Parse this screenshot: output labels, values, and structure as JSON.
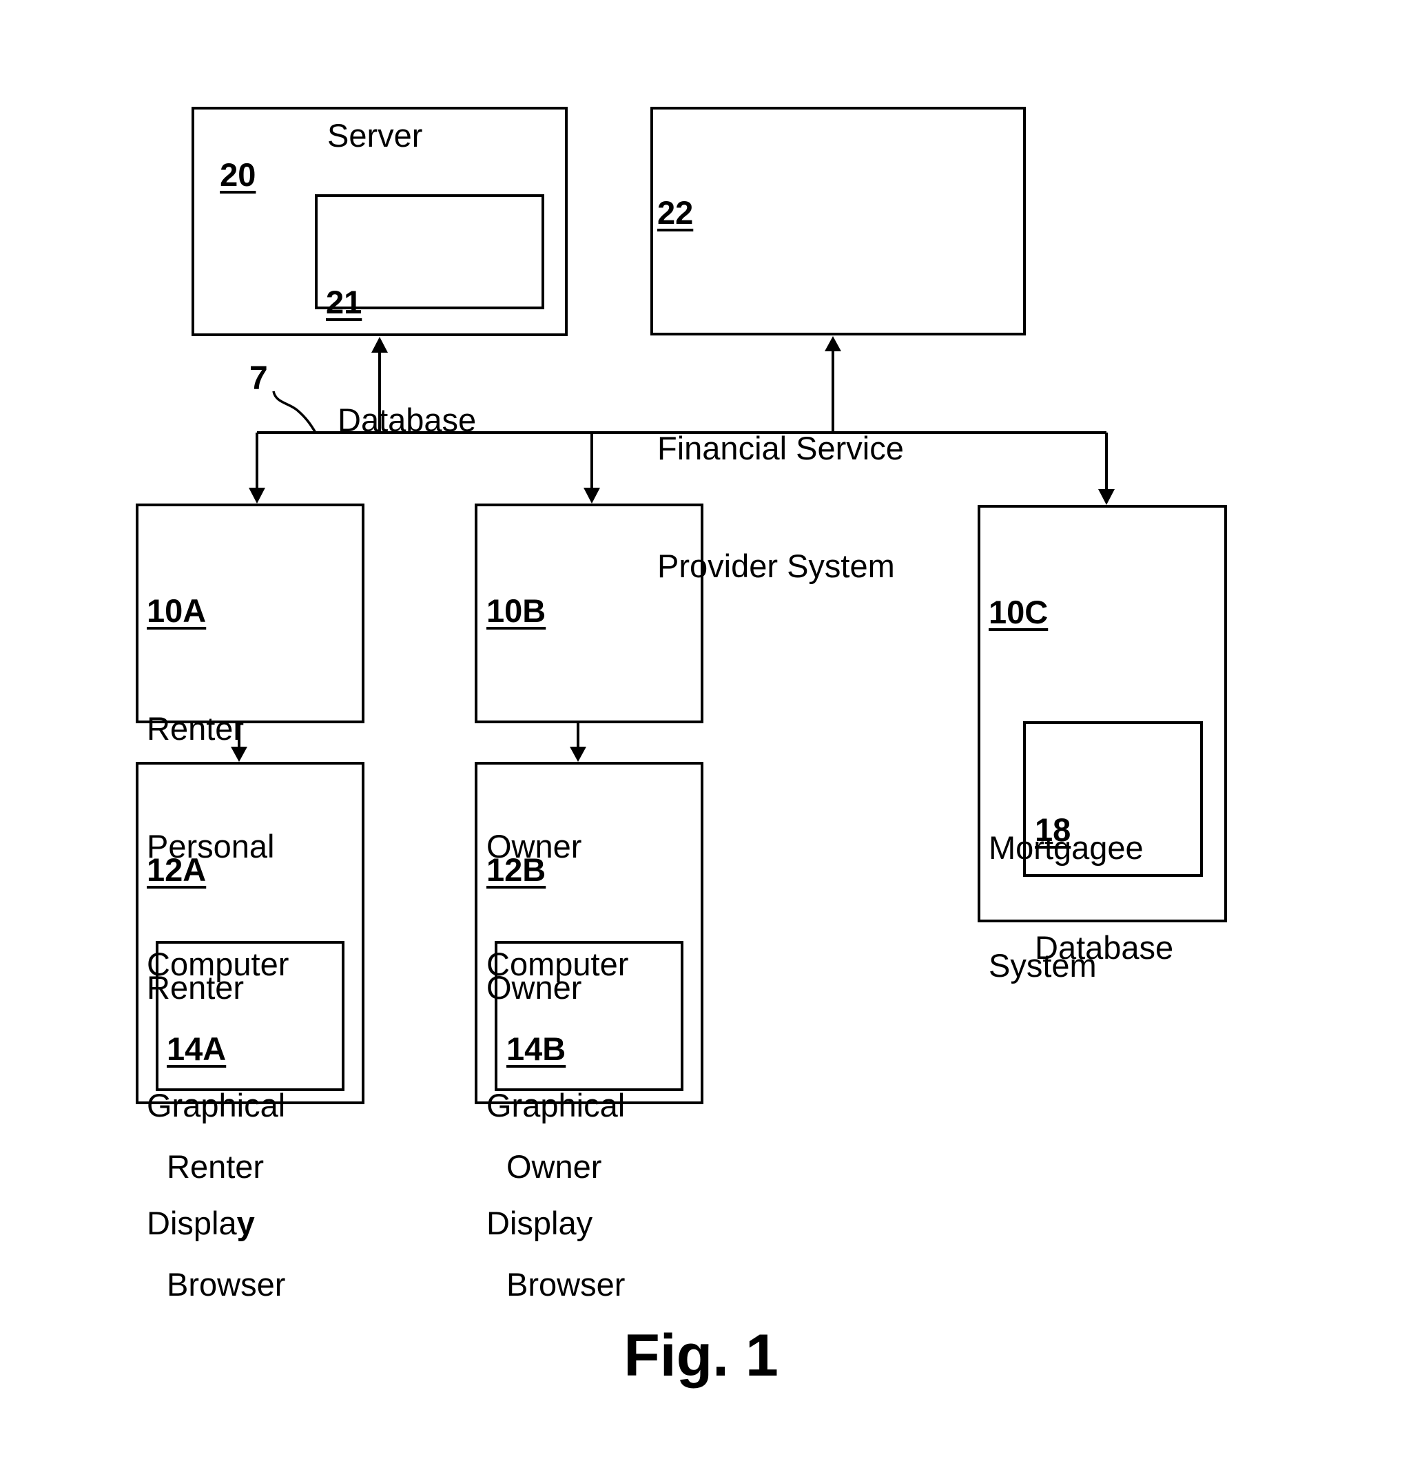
{
  "figure": {
    "caption": "Fig. 1",
    "network_ref": "7"
  },
  "nodes": {
    "server": {
      "ref": "20",
      "title": "Server"
    },
    "server_db": {
      "ref": "21",
      "lines": [
        "Database"
      ]
    },
    "fsp": {
      "ref": "22",
      "lines": [
        "Financial Service",
        "Provider System"
      ]
    },
    "renter_pc": {
      "ref": "10A",
      "lines": [
        "Renter",
        "Personal",
        "Computer"
      ]
    },
    "renter_display": {
      "ref": "12A",
      "lines": [
        "Renter",
        "Graphical",
        "Displa"
      ],
      "last_char_bold": "y"
    },
    "renter_browser": {
      "ref": "14A",
      "lines": [
        "Renter",
        "Browser"
      ]
    },
    "owner_pc": {
      "ref": "10B",
      "lines": [
        "Owner",
        "Computer"
      ]
    },
    "owner_display": {
      "ref": "12B",
      "lines": [
        "Owner",
        "Graphical",
        "Display"
      ]
    },
    "owner_browser": {
      "ref": "14B",
      "lines": [
        "Owner",
        "Browser"
      ]
    },
    "mortgagee": {
      "ref": "10C",
      "lines": [
        "Mortgagee",
        "System"
      ]
    },
    "mortgagee_db": {
      "ref": "18",
      "lines": [
        "Database"
      ]
    }
  },
  "connections": [
    {
      "from": "network",
      "to": "server",
      "direction": "up"
    },
    {
      "from": "network",
      "to": "fsp",
      "direction": "up"
    },
    {
      "from": "network",
      "to": "renter_pc",
      "direction": "down"
    },
    {
      "from": "network",
      "to": "owner_pc",
      "direction": "down"
    },
    {
      "from": "network",
      "to": "mortgagee",
      "direction": "down"
    },
    {
      "from": "renter_pc",
      "to": "renter_display",
      "direction": "down"
    },
    {
      "from": "owner_pc",
      "to": "owner_display",
      "direction": "down"
    }
  ]
}
